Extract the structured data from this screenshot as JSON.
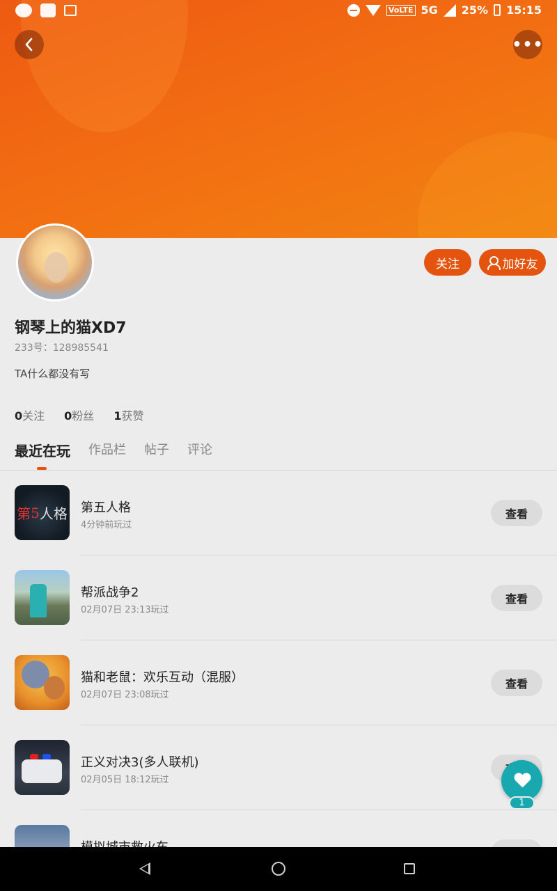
{
  "status_bar": {
    "network": "VoLTE",
    "network_type": "5G",
    "battery": "25%",
    "time": "15:15",
    "left_icons": [
      "wechat-icon",
      "app-icon",
      "image-icon"
    ]
  },
  "header": {
    "back_icon": "chevron-left-icon",
    "more_label": "•••"
  },
  "profile": {
    "name": "钢琴上的猫XD7",
    "id_line": "233号：128985541",
    "bio": "TA什么都没有写",
    "follow_label": "关注",
    "add_friend_label": "加好友",
    "stats": [
      {
        "value": "0",
        "label": "关注"
      },
      {
        "value": "0",
        "label": "粉丝"
      },
      {
        "value": "1",
        "label": "获赞"
      }
    ]
  },
  "tabs": [
    {
      "label": "最近在玩",
      "active": true
    },
    {
      "label": "作品栏",
      "active": false
    },
    {
      "label": "帖子",
      "active": false
    },
    {
      "label": "评论",
      "active": false
    }
  ],
  "games": [
    {
      "name": "第五人格",
      "time": "4分钟前玩过",
      "button": "查看",
      "thumb_text_a": "第",
      "thumb_text_b": "5",
      "thumb_text_c": "人格"
    },
    {
      "name": "帮派战争2",
      "time": "02月07日 23:13玩过",
      "button": "查看"
    },
    {
      "name": "猫和老鼠：欢乐互动（混服）",
      "time": "02月07日 23:08玩过",
      "button": "查看"
    },
    {
      "name": "正义对决3(多人联机)",
      "time": "02月05日 18:12玩过",
      "button": "查看"
    },
    {
      "name": "模拟城市救火车",
      "time": "",
      "button": "查看"
    }
  ],
  "like_fab": {
    "count": "1",
    "icon": "heart-icon"
  },
  "nav_bar": {
    "icons": [
      "back-triangle-icon",
      "home-circle-icon",
      "recents-square-icon"
    ]
  },
  "colors": {
    "accent": "#e5540f",
    "banner": "#f06a14",
    "fab": "#18a9b0"
  }
}
